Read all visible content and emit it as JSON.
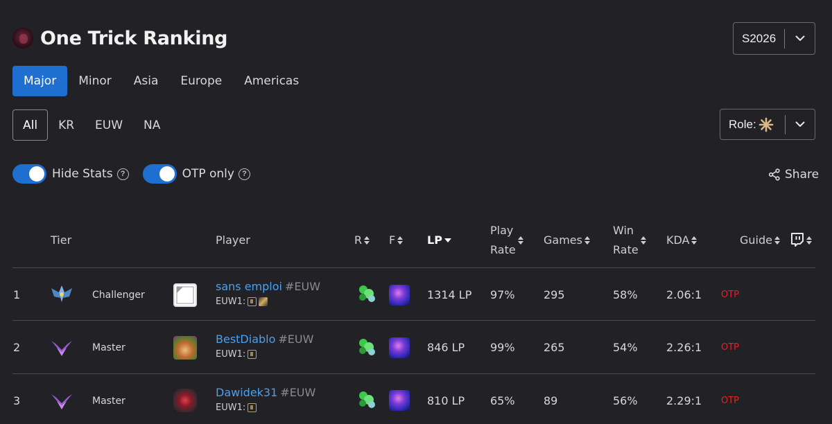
{
  "header": {
    "title": "One Trick Ranking",
    "season": "S2026"
  },
  "tabs": [
    {
      "label": "Major",
      "active": true
    },
    {
      "label": "Minor",
      "active": false
    },
    {
      "label": "Asia",
      "active": false
    },
    {
      "label": "Europe",
      "active": false
    },
    {
      "label": "Americas",
      "active": false
    }
  ],
  "regions": [
    {
      "label": "All",
      "active": true
    },
    {
      "label": "KR",
      "active": false
    },
    {
      "label": "EUW",
      "active": false
    },
    {
      "label": "NA",
      "active": false
    }
  ],
  "role_filter": {
    "label": "Role:",
    "icon": "all-roles-icon"
  },
  "toggles": [
    {
      "label": "Hide Stats",
      "on": true
    },
    {
      "label": "OTP only",
      "on": true
    }
  ],
  "share_label": "Share",
  "table": {
    "columns": {
      "tier": "Tier",
      "player": "Player",
      "r": "R",
      "f": "F",
      "lp": "LP",
      "play_rate_1": "Play",
      "play_rate_2": "Rate",
      "games": "Games",
      "win_rate_1": "Win",
      "win_rate_2": "Rate",
      "kda": "KDA",
      "guide": "Guide"
    },
    "rows": [
      {
        "rank": "1",
        "tier": "Challenger",
        "name": "sans emploi",
        "tag": "#EUW",
        "server": "EUW1:",
        "lp": "1314 LP",
        "play_rate": "97%",
        "games": "295",
        "win_rate": "58%",
        "kda": "2.06:1",
        "otp": "OTP"
      },
      {
        "rank": "2",
        "tier": "Master",
        "name": "BestDiablo",
        "tag": "#EUW",
        "server": "EUW1:",
        "lp": "846 LP",
        "play_rate": "99%",
        "games": "265",
        "win_rate": "54%",
        "kda": "2.26:1",
        "otp": "OTP"
      },
      {
        "rank": "3",
        "tier": "Master",
        "name": "Dawidek31",
        "tag": "#EUW",
        "server": "EUW1:",
        "lp": "810 LP",
        "play_rate": "65%",
        "games": "89",
        "win_rate": "56%",
        "kda": "2.29:1",
        "otp": "OTP"
      }
    ]
  },
  "colors": {
    "accent": "#1f6fd0",
    "player_link": "#4aa0ee",
    "otp": "#e02424",
    "background": "#222226"
  }
}
